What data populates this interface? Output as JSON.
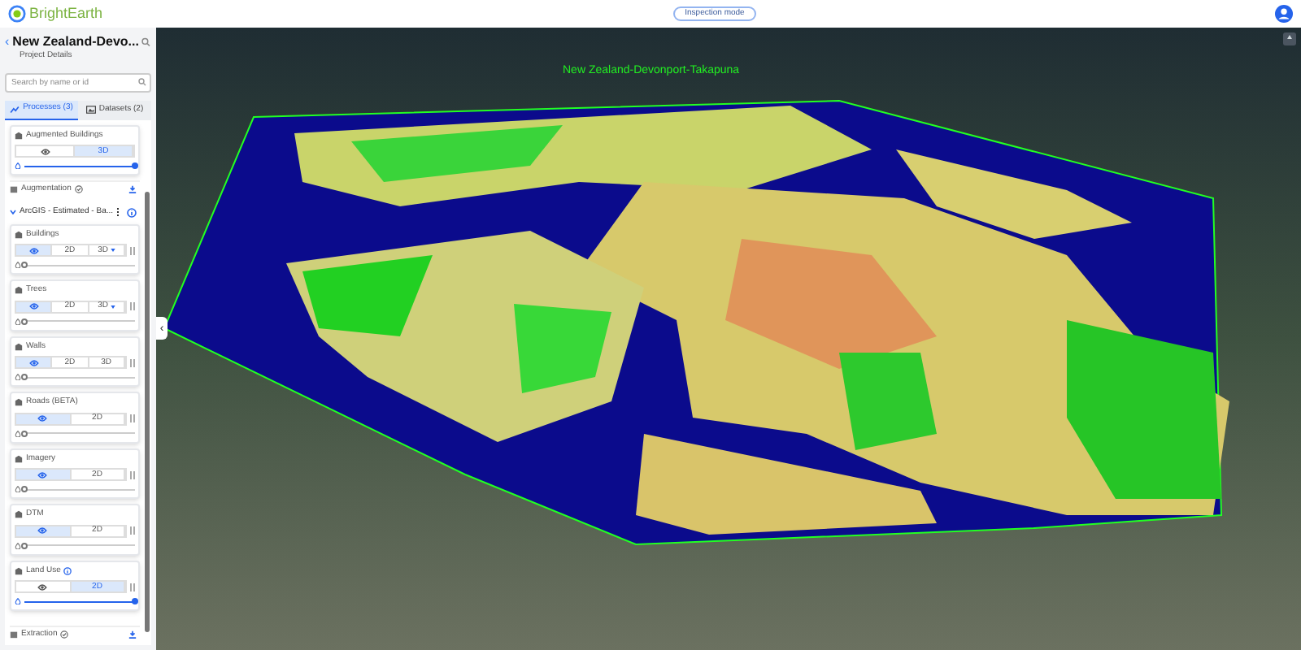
{
  "header": {
    "logo": "BrightEarth",
    "mode_button": "Inspection mode"
  },
  "sidebar": {
    "back": "‹",
    "title": "New Zealand-Devo...",
    "subtitle": "Project Details",
    "search": {
      "placeholder": "Search by name or id"
    },
    "tabs": [
      {
        "label": "Processes (3)",
        "kind": "processes",
        "selected": true
      },
      {
        "label": "Datasets (2)",
        "kind": "datasets",
        "selected": false
      }
    ],
    "augmented": {
      "name": "Augmented Buildings",
      "segments": [
        {
          "kind": "eye",
          "selected": false
        },
        {
          "kind": "text",
          "label": "3D",
          "selected": true
        }
      ],
      "level": 1
    },
    "augmentation": {
      "label": "Augmentation"
    },
    "group": {
      "title": "ArcGIS - Estimated - Ba...",
      "expanded": true
    },
    "layers": [
      {
        "name": "Buildings",
        "segments": [
          {
            "kind": "eye",
            "selected": true
          },
          {
            "kind": "text",
            "label": "2D",
            "selected": false
          },
          {
            "kind": "menu",
            "label": "3D",
            "selected": false
          }
        ],
        "level": 0,
        "info": false
      },
      {
        "name": "Trees",
        "segments": [
          {
            "kind": "eye",
            "selected": true
          },
          {
            "kind": "text",
            "label": "2D",
            "selected": false
          },
          {
            "kind": "menu",
            "label": "3D",
            "selected": false
          }
        ],
        "level": 0,
        "info": false
      },
      {
        "name": "Walls",
        "segments": [
          {
            "kind": "eye",
            "selected": true
          },
          {
            "kind": "text",
            "label": "2D",
            "selected": false
          },
          {
            "kind": "text",
            "label": "3D",
            "selected": false
          }
        ],
        "level": 0,
        "info": false
      },
      {
        "name": "Roads (BETA)",
        "segments": [
          {
            "kind": "eye",
            "selected": true
          },
          {
            "kind": "text",
            "label": "2D",
            "selected": false
          }
        ],
        "level": 0,
        "info": false
      },
      {
        "name": "Imagery",
        "segments": [
          {
            "kind": "eye",
            "selected": true
          },
          {
            "kind": "text",
            "label": "2D",
            "selected": false
          }
        ],
        "level": 0,
        "info": false
      },
      {
        "name": "DTM",
        "segments": [
          {
            "kind": "eye",
            "selected": true
          },
          {
            "kind": "text",
            "label": "2D",
            "selected": false
          }
        ],
        "level": 0,
        "info": false
      },
      {
        "name": "Land Use",
        "segments": [
          {
            "kind": "eye",
            "selected": false
          },
          {
            "kind": "text",
            "label": "2D",
            "selected": true
          }
        ],
        "level": 1,
        "info": true
      }
    ],
    "extraction": {
      "label": "Extraction"
    }
  },
  "map": {
    "label": "New Zealand-Devonport-Takapuna",
    "collapse": "‹"
  }
}
